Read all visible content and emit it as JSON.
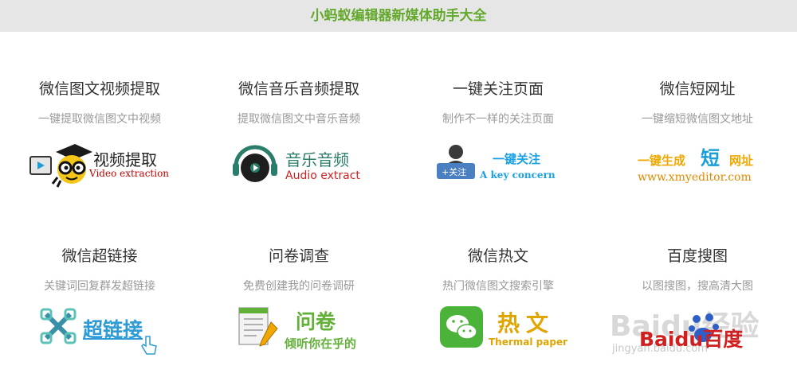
{
  "header": {
    "title": "小蚂蚁编辑器新媒体助手大全"
  },
  "cards": [
    {
      "title": "微信图文视频提取",
      "desc": "一键提取微信图文中视频",
      "logo_text": "视频提取",
      "logo_sub": "Video extraction"
    },
    {
      "title": "微信音乐音频提取",
      "desc": "提取微信图文中音乐音频",
      "logo_text": "音乐音频",
      "logo_sub": "Audio extract"
    },
    {
      "title": "一键关注页面",
      "desc": "制作不一样的关注页面",
      "logo_text": "一键关注",
      "logo_sub": "A key concern",
      "button_text": "+关注"
    },
    {
      "title": "微信短网址",
      "desc": "一键缩短微信图文地址",
      "logo_text_a": "一键生成",
      "logo_text_b": "短",
      "logo_text_c": "网址",
      "logo_sub": "www.xmyeditor.com"
    },
    {
      "title": "微信超链接",
      "desc": "关键词回复群发超链接",
      "logo_text": "超链接"
    },
    {
      "title": "问卷调查",
      "desc": "免费创建我的问卷调研",
      "logo_text": "问卷",
      "logo_sub": "倾听你在乎的"
    },
    {
      "title": "微信热文",
      "desc": "热门微信图文搜索引擎",
      "logo_text": "热文",
      "logo_sub": "Thermal paper"
    },
    {
      "title": "百度搜图",
      "desc": "以图搜图，搜高清大图",
      "logo_text": "Baidu百度",
      "watermark_text": "Baidu经验",
      "watermark_url": "jingyan.baidu.com"
    }
  ]
}
